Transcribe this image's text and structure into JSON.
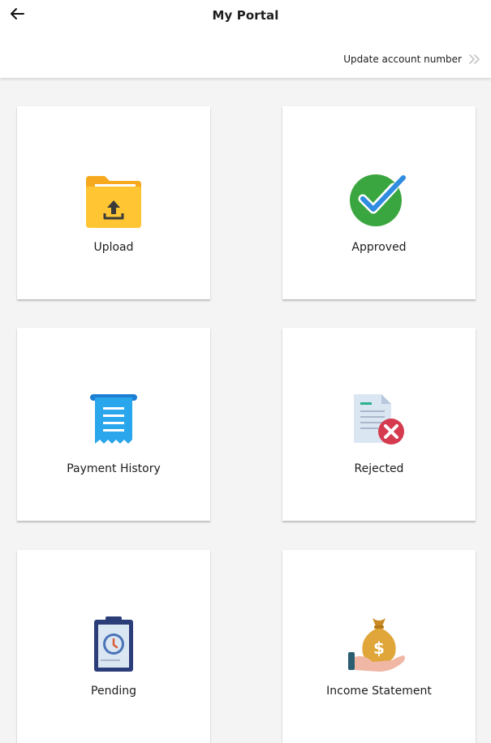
{
  "header": {
    "title": "My Portal",
    "back_icon": "arrow-left-icon",
    "update_link_label": "Update account number",
    "update_link_icon": "double-chevron-right-icon"
  },
  "tiles": [
    {
      "label": "Upload",
      "icon": "folder-upload-icon"
    },
    {
      "label": "Approved",
      "icon": "check-circle-icon"
    },
    {
      "label": "Payment History",
      "icon": "receipt-icon"
    },
    {
      "label": "Rejected",
      "icon": "document-rejected-icon"
    },
    {
      "label": "Pending",
      "icon": "clipboard-clock-icon"
    },
    {
      "label": "Income Statement",
      "icon": "money-bag-hand-icon"
    }
  ],
  "colors": {
    "background": "#f4f4f4",
    "card": "#ffffff",
    "folder": "#ffc533",
    "approved_green": "#3aa63f",
    "approved_check": "#2f8ce0",
    "receipt_blue": "#2aa6ec",
    "reject_red": "#d53a4f",
    "pending_navy": "#2b3d78",
    "money_gold": "#e0a63a"
  }
}
